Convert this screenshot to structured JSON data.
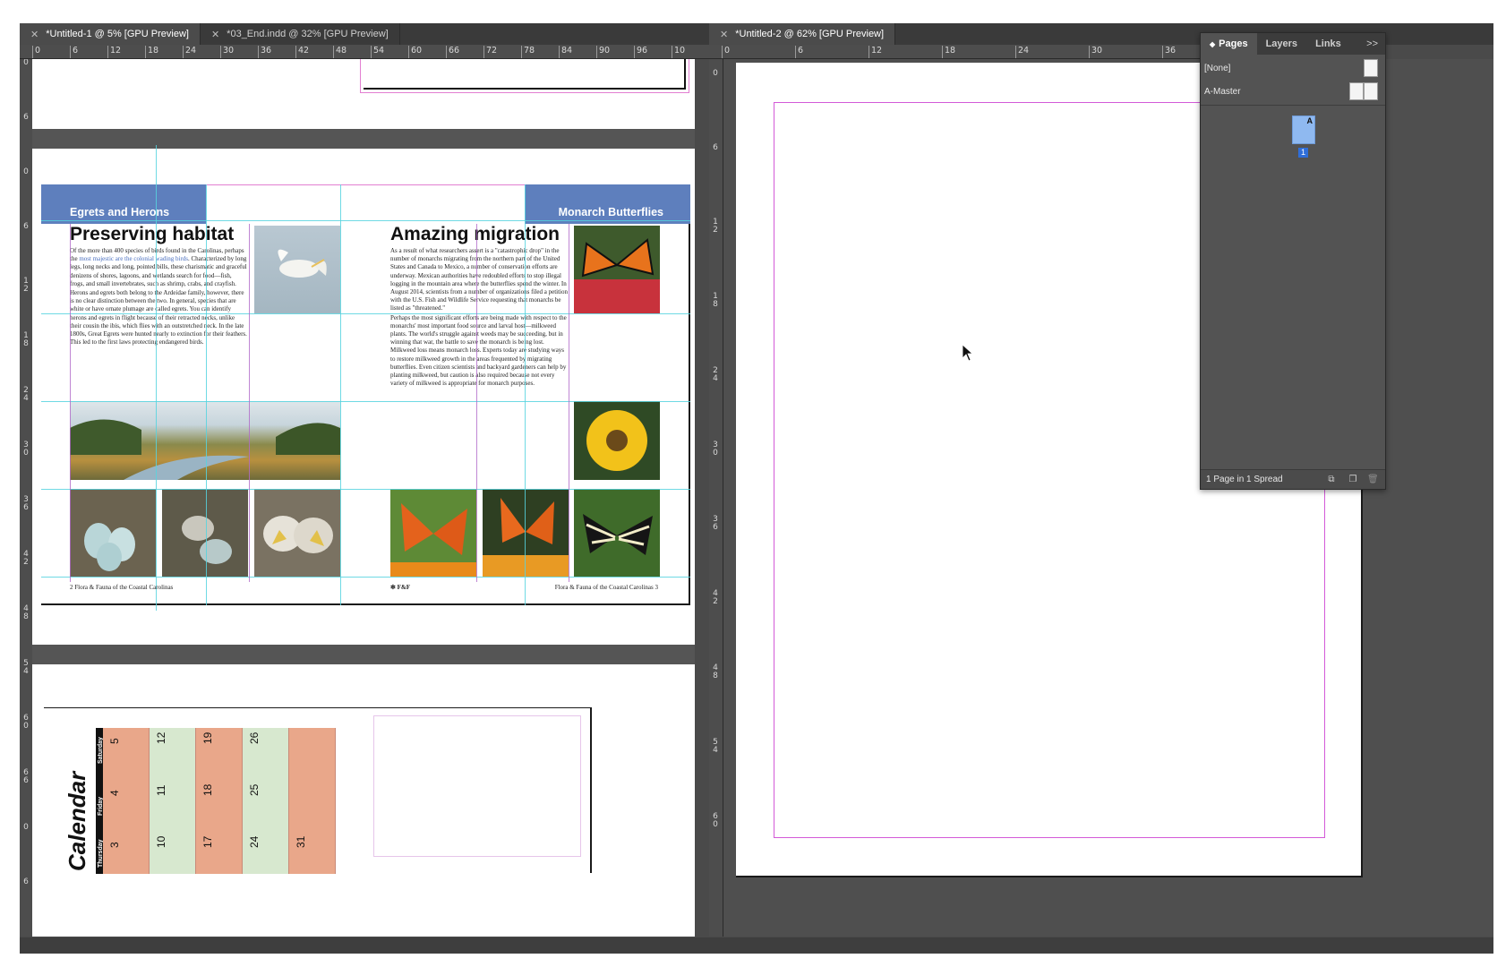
{
  "left_window": {
    "tabs": [
      {
        "label": "*Untitled-1 @ 5% [GPU Preview]"
      },
      {
        "label": "*03_End.indd @ 32% [GPU Preview]"
      }
    ],
    "ruler_h": [
      "0",
      "6",
      "12",
      "18",
      "24",
      "30",
      "36",
      "42",
      "48",
      "54",
      "60",
      "66",
      "72",
      "78",
      "84",
      "90",
      "96",
      "10"
    ],
    "ruler_v": [
      "0",
      "6",
      "0",
      "6",
      "1 2",
      "1 8",
      "2 4",
      "3 0",
      "3 6",
      "4 2",
      "4 8",
      "5 4",
      "6 0",
      "6 6",
      "0",
      "6"
    ]
  },
  "right_window": {
    "tab": {
      "label": "*Untitled-2 @ 62% [GPU Preview]"
    },
    "ruler_h": [
      "0",
      "6",
      "12",
      "18",
      "24",
      "30",
      "36"
    ],
    "ruler_v": [
      "0",
      "6",
      "1 2",
      "1 8",
      "2 4",
      "3 0",
      "3 6",
      "4 2",
      "4 8",
      "5 4",
      "6 0"
    ]
  },
  "spread": {
    "left_band": "Egrets and Herons",
    "right_band": "Monarch Butterflies",
    "left_title": "Preserving habitat",
    "right_title": "Amazing migration",
    "left_body": [
      [
        "Of the more than 400 species of birds found in the Carolinas, perhaps the ",
        "most majestic are the colonial wading birds",
        ". Characterized by long legs, long necks and long, pointed bills, these charismatic and graceful denizens of shores, lagoons, and wetlands search for food—fish, frogs, and small invertebrates, such as shrimp, crabs, and crayfish."
      ],
      [
        "Herons and egrets both belong to the Ardeidae family, however, there is no clear distinction between the two. In general, species that are white or have ornate plumage are called egrets. You can identify herons and egrets in flight because of their retracted necks, unlike their cousin the ibis, which flies with an outstretched neck. In the late 1800s, Great Egrets were hunted nearly to extinction for their feathers. This led to the first laws protecting endangered birds.",
        "",
        ""
      ]
    ],
    "right_body": [
      "As a result of what researchers assert is a \"catastrophic drop\" in the number of monarchs migrating from the northern part of the United States and Canada to Mexico, a number of conservation efforts are underway. Mexican authorities have redoubled efforts to stop illegal logging in the mountain area where the butterflies spend the winter. In August 2014, scientists from a number of organizations filed a petition with the U.S. Fish and Wildlife Service requesting that monarchs be listed as \"threatened.\"",
      "Perhaps the most significant efforts are being made with respect to the monarchs' most important food source and larval host—milkweed plants. The world's struggle against weeds may be succeeding, but in winning that war, the battle to save the monarch is being lost. Milkweed loss means monarch loss. Experts today are studying ways to restore milkweed growth in the areas frequented by migrating butterflies. Even citizen scientists and backyard gardeners can help by planting milkweed, but caution is also required because not every variety of milkweed is appropriate for monarch purposes."
    ],
    "left_folio": "2    Flora & Fauna of the Coastal Carolinas",
    "right_folio": "Flora & Fauna of the Coastal Carolinas    3",
    "logo": "F&F"
  },
  "calendar": {
    "title": "Calendar",
    "days": [
      "Saturday",
      "Friday",
      "Thursday"
    ],
    "rows": [
      [
        "5",
        "12",
        "19",
        "26",
        ""
      ],
      [
        "4",
        "11",
        "18",
        "25",
        ""
      ],
      [
        "3",
        "10",
        "17",
        "24",
        "31"
      ]
    ],
    "colors": {
      "salmon": "#e9a78a",
      "green": "#d7e8cf"
    }
  },
  "pages_panel": {
    "tabs": [
      "Pages",
      "Layers",
      "Links"
    ],
    "menu": ">>",
    "none_label": "[None]",
    "master_label": "A-Master",
    "page_prefix": "A",
    "page_number": "1",
    "footer": "1 Page in 1 Spread"
  },
  "colors": {
    "band": "#5e7fbd",
    "guide": "#56d4df",
    "margin": "#d35ad8"
  }
}
